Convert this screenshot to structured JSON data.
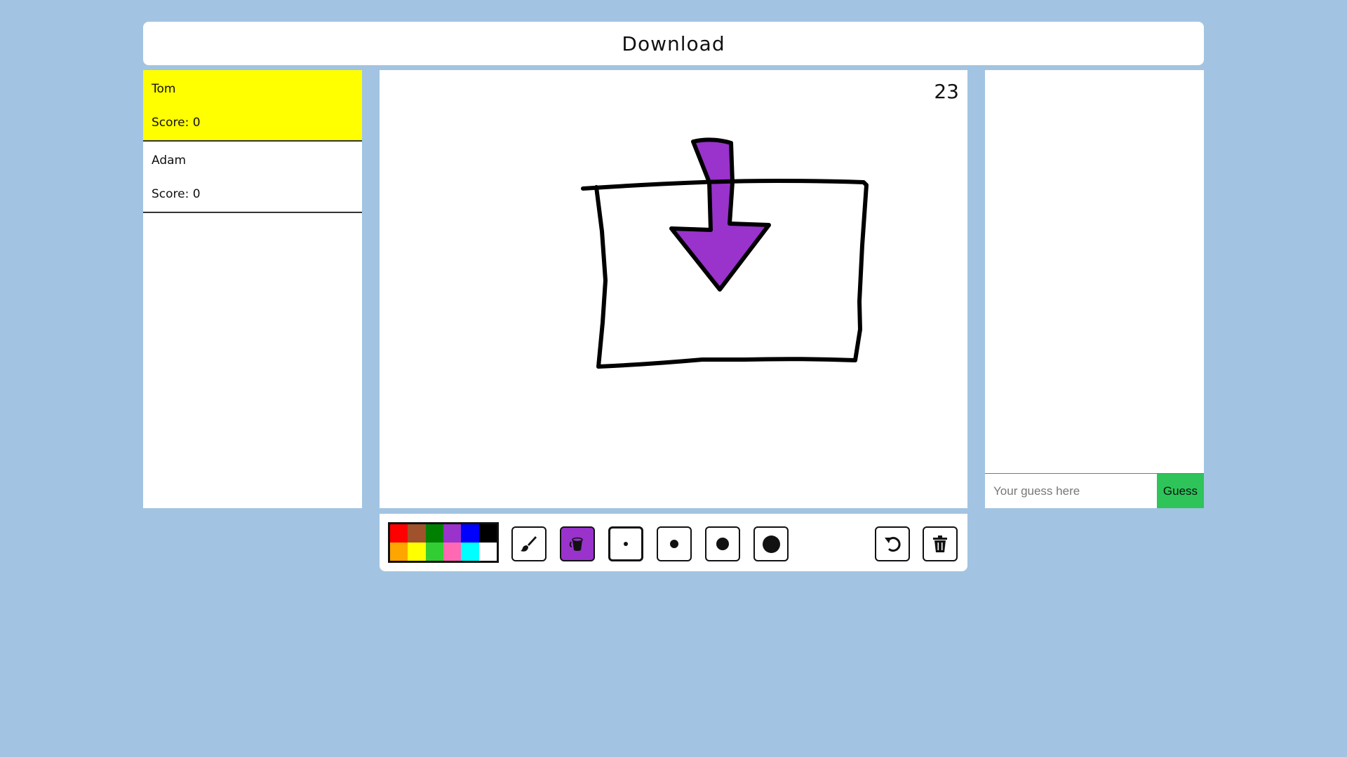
{
  "header": {
    "word": "Download"
  },
  "players": [
    {
      "name": "Tom",
      "score_label": "Score: 0",
      "active": true
    },
    {
      "name": "Adam",
      "score_label": "Score: 0",
      "active": false
    }
  ],
  "canvas": {
    "timer": "23"
  },
  "chat": {
    "guess_placeholder": "Your guess here",
    "guess_button_label": "Guess"
  },
  "toolbar": {
    "palette": [
      "#ff0000",
      "#a0522d",
      "#008000",
      "#9933cc",
      "#0000ff",
      "#000000",
      "#ffa500",
      "#ffff00",
      "#32cd32",
      "#ff69b4",
      "#00ffff",
      "#ffffff"
    ],
    "tools": [
      "brush-icon",
      "fill-bucket-icon",
      "size-small-icon",
      "size-medium-icon",
      "size-large-icon",
      "size-xlarge-icon",
      "undo-icon",
      "trash-icon"
    ],
    "selected_tool": "fill-bucket",
    "selected_size": "size-small",
    "accent_color": "#9933cc"
  },
  "colors": {
    "background": "#a2c4e2",
    "active_player": "#ffff00",
    "guess_button": "#2ec45a"
  }
}
